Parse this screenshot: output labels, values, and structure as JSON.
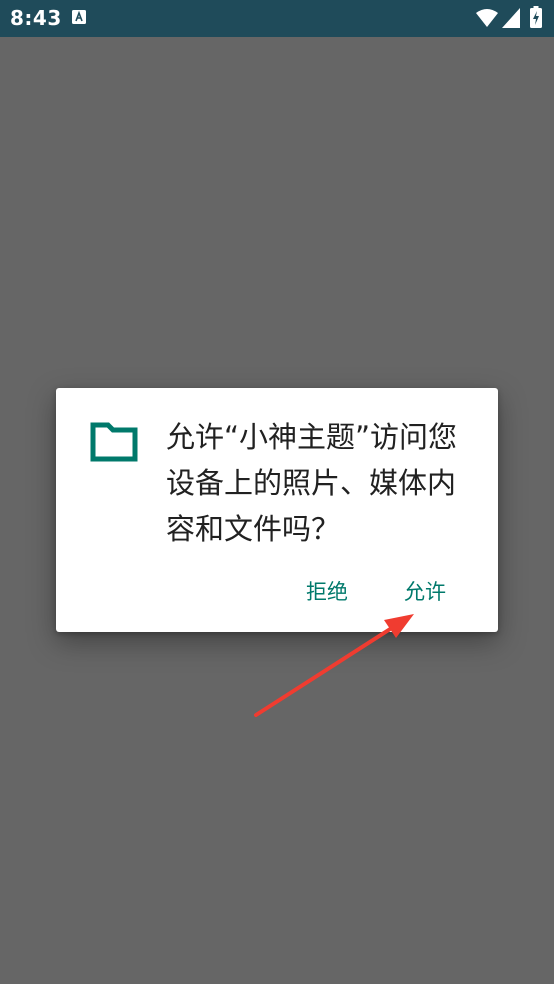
{
  "status_bar": {
    "time": "8:43",
    "notification_icon": "a-letter-icon",
    "wifi_icon": "wifi-icon",
    "signal_icon": "cell-signal-icon",
    "battery_icon": "battery-charging-icon",
    "background_color": "#1f4b5a"
  },
  "dialog": {
    "icon": "folder-icon",
    "icon_color": "#00796b",
    "message": "允许“小神主题”访问您设备上的照片、媒体内容和文件吗？",
    "buttons": {
      "deny_label": "拒绝",
      "allow_label": "允许"
    },
    "button_color": "#00796b"
  },
  "annotation": {
    "type": "red-arrow",
    "points_to": "allow-button",
    "color": "#f03c30"
  },
  "scrim_color": "#666666"
}
